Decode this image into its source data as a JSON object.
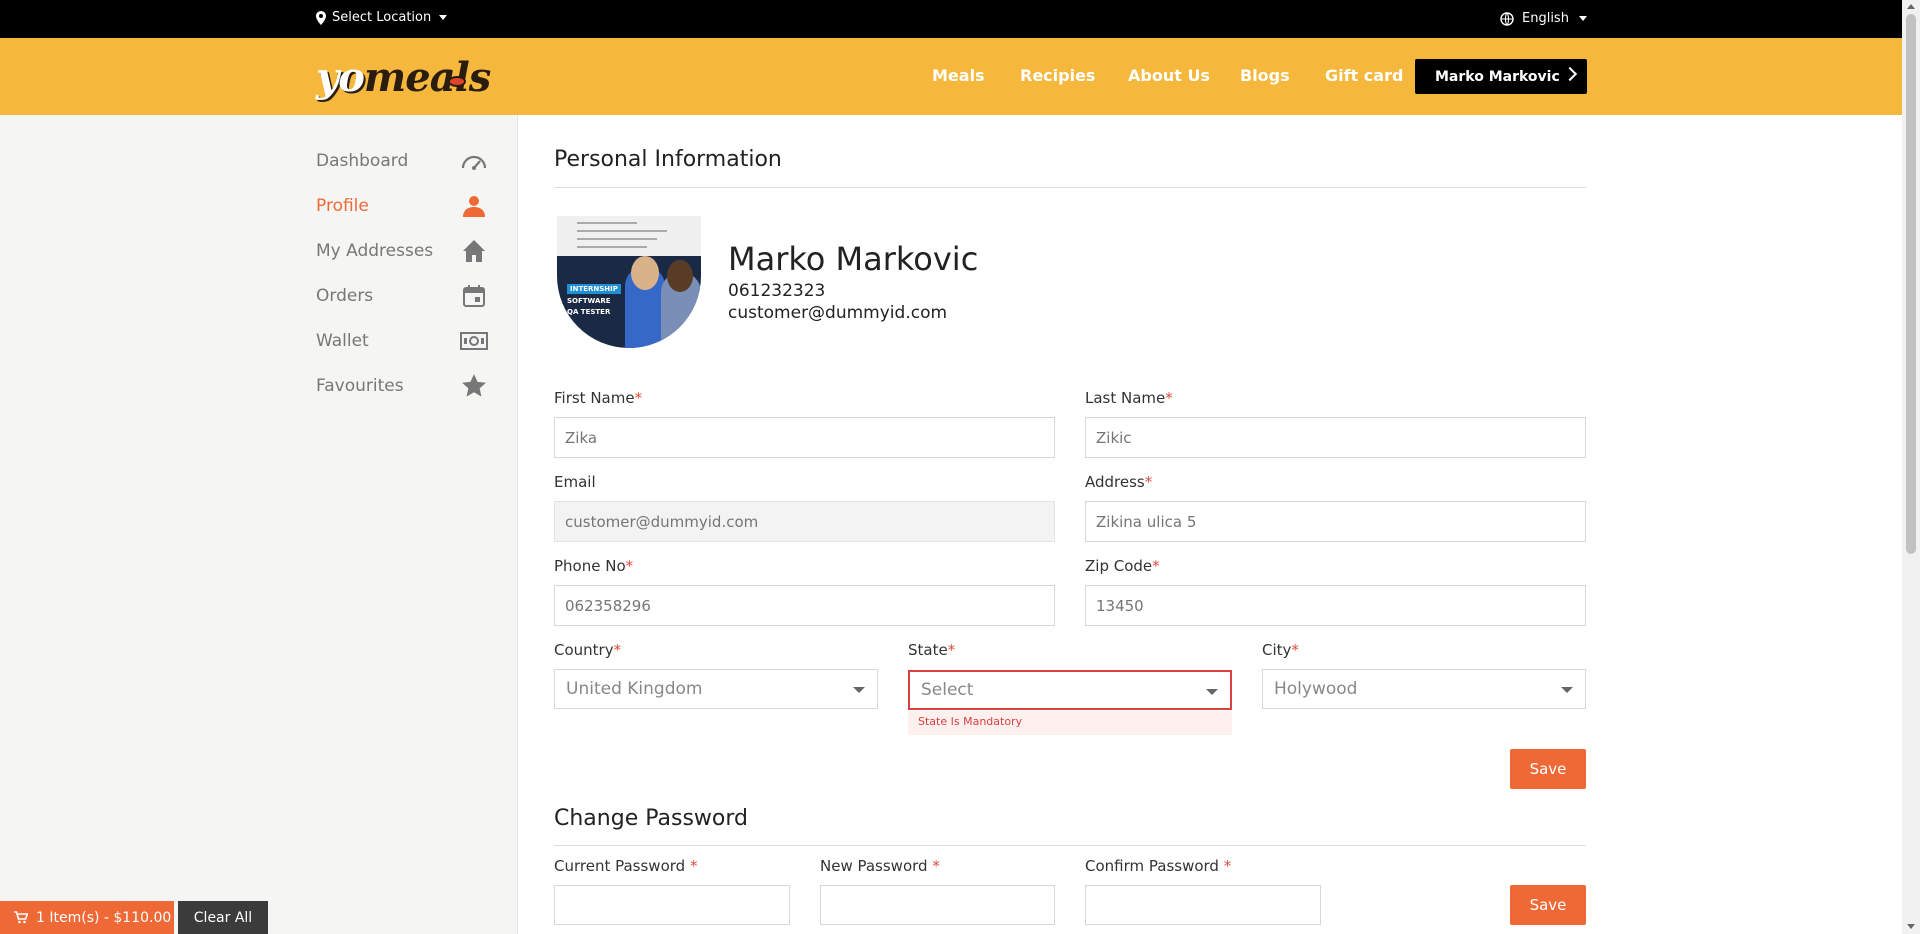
{
  "topbar": {
    "location_label": "Select Location",
    "language": "English"
  },
  "brand": {
    "logo_yo": "yo",
    "logo_meals": "meals"
  },
  "nav": {
    "items": [
      "Meals",
      "Recipies",
      "About Us",
      "Blogs",
      "Gift card"
    ],
    "user_button": "Marko Markovic"
  },
  "sidebar": {
    "items": [
      {
        "label": "Dashboard",
        "icon": "speedometer-icon"
      },
      {
        "label": "Profile",
        "icon": "person-icon",
        "active": true
      },
      {
        "label": "My Addresses",
        "icon": "home-icon"
      },
      {
        "label": "Orders",
        "icon": "calendar-icon"
      },
      {
        "label": "Wallet",
        "icon": "money-icon"
      },
      {
        "label": "Favourites",
        "icon": "star-icon"
      }
    ]
  },
  "profile": {
    "section_title": "Personal Information",
    "name": "Marko Markovic",
    "phone": "061232323",
    "email": "customer@dummyid.com",
    "avatar_text": {
      "tag": "INTERNSHIP",
      "line1": "SOFTWARE",
      "line2": "QA TESTER"
    }
  },
  "form": {
    "first_name": {
      "label": "First Name",
      "placeholder": "Zika"
    },
    "last_name": {
      "label": "Last Name",
      "placeholder": "Zikic"
    },
    "email": {
      "label": "Email",
      "placeholder": "customer@dummyid.com"
    },
    "address": {
      "label": "Address",
      "placeholder": "Zikina ulica 5"
    },
    "phone": {
      "label": "Phone No",
      "placeholder": "062358296"
    },
    "zip": {
      "label": "Zip Code",
      "placeholder": "13450"
    },
    "country": {
      "label": "Country",
      "value": "United Kingdom"
    },
    "state": {
      "label": "State",
      "value": "Select",
      "error": "State Is Mandatory"
    },
    "city": {
      "label": "City",
      "value": "Holywood"
    },
    "required_mark": "*",
    "save_label": "Save"
  },
  "password": {
    "section_title": "Change Password",
    "current": {
      "label": "Current Password"
    },
    "new": {
      "label": "New Password"
    },
    "confirm": {
      "label": "Confirm Password"
    },
    "required_mark": "*",
    "save_label": "Save"
  },
  "cart": {
    "summary": "1 Item(s) - $110.00",
    "clear_label": "Clear All"
  },
  "colors": {
    "accent": "#ef6937",
    "header": "#f5b83d",
    "error": "#d94040"
  }
}
